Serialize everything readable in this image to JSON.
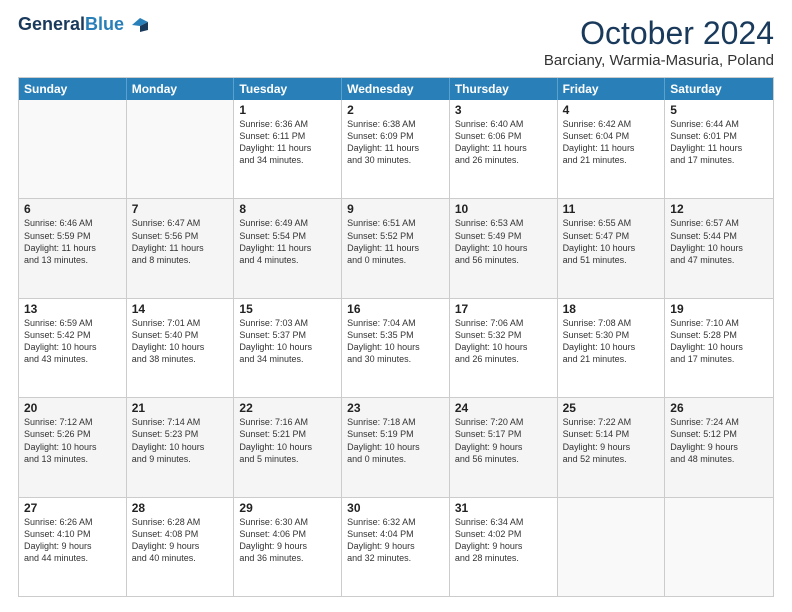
{
  "header": {
    "logo_line1": "General",
    "logo_line2": "Blue",
    "main_title": "October 2024",
    "subtitle": "Barciany, Warmia-Masuria, Poland"
  },
  "days_of_week": [
    "Sunday",
    "Monday",
    "Tuesday",
    "Wednesday",
    "Thursday",
    "Friday",
    "Saturday"
  ],
  "weeks": [
    [
      {
        "day": "",
        "text": ""
      },
      {
        "day": "",
        "text": ""
      },
      {
        "day": "1",
        "text": "Sunrise: 6:36 AM\nSunset: 6:11 PM\nDaylight: 11 hours\nand 34 minutes."
      },
      {
        "day": "2",
        "text": "Sunrise: 6:38 AM\nSunset: 6:09 PM\nDaylight: 11 hours\nand 30 minutes."
      },
      {
        "day": "3",
        "text": "Sunrise: 6:40 AM\nSunset: 6:06 PM\nDaylight: 11 hours\nand 26 minutes."
      },
      {
        "day": "4",
        "text": "Sunrise: 6:42 AM\nSunset: 6:04 PM\nDaylight: 11 hours\nand 21 minutes."
      },
      {
        "day": "5",
        "text": "Sunrise: 6:44 AM\nSunset: 6:01 PM\nDaylight: 11 hours\nand 17 minutes."
      }
    ],
    [
      {
        "day": "6",
        "text": "Sunrise: 6:46 AM\nSunset: 5:59 PM\nDaylight: 11 hours\nand 13 minutes."
      },
      {
        "day": "7",
        "text": "Sunrise: 6:47 AM\nSunset: 5:56 PM\nDaylight: 11 hours\nand 8 minutes."
      },
      {
        "day": "8",
        "text": "Sunrise: 6:49 AM\nSunset: 5:54 PM\nDaylight: 11 hours\nand 4 minutes."
      },
      {
        "day": "9",
        "text": "Sunrise: 6:51 AM\nSunset: 5:52 PM\nDaylight: 11 hours\nand 0 minutes."
      },
      {
        "day": "10",
        "text": "Sunrise: 6:53 AM\nSunset: 5:49 PM\nDaylight: 10 hours\nand 56 minutes."
      },
      {
        "day": "11",
        "text": "Sunrise: 6:55 AM\nSunset: 5:47 PM\nDaylight: 10 hours\nand 51 minutes."
      },
      {
        "day": "12",
        "text": "Sunrise: 6:57 AM\nSunset: 5:44 PM\nDaylight: 10 hours\nand 47 minutes."
      }
    ],
    [
      {
        "day": "13",
        "text": "Sunrise: 6:59 AM\nSunset: 5:42 PM\nDaylight: 10 hours\nand 43 minutes."
      },
      {
        "day": "14",
        "text": "Sunrise: 7:01 AM\nSunset: 5:40 PM\nDaylight: 10 hours\nand 38 minutes."
      },
      {
        "day": "15",
        "text": "Sunrise: 7:03 AM\nSunset: 5:37 PM\nDaylight: 10 hours\nand 34 minutes."
      },
      {
        "day": "16",
        "text": "Sunrise: 7:04 AM\nSunset: 5:35 PM\nDaylight: 10 hours\nand 30 minutes."
      },
      {
        "day": "17",
        "text": "Sunrise: 7:06 AM\nSunset: 5:32 PM\nDaylight: 10 hours\nand 26 minutes."
      },
      {
        "day": "18",
        "text": "Sunrise: 7:08 AM\nSunset: 5:30 PM\nDaylight: 10 hours\nand 21 minutes."
      },
      {
        "day": "19",
        "text": "Sunrise: 7:10 AM\nSunset: 5:28 PM\nDaylight: 10 hours\nand 17 minutes."
      }
    ],
    [
      {
        "day": "20",
        "text": "Sunrise: 7:12 AM\nSunset: 5:26 PM\nDaylight: 10 hours\nand 13 minutes."
      },
      {
        "day": "21",
        "text": "Sunrise: 7:14 AM\nSunset: 5:23 PM\nDaylight: 10 hours\nand 9 minutes."
      },
      {
        "day": "22",
        "text": "Sunrise: 7:16 AM\nSunset: 5:21 PM\nDaylight: 10 hours\nand 5 minutes."
      },
      {
        "day": "23",
        "text": "Sunrise: 7:18 AM\nSunset: 5:19 PM\nDaylight: 10 hours\nand 0 minutes."
      },
      {
        "day": "24",
        "text": "Sunrise: 7:20 AM\nSunset: 5:17 PM\nDaylight: 9 hours\nand 56 minutes."
      },
      {
        "day": "25",
        "text": "Sunrise: 7:22 AM\nSunset: 5:14 PM\nDaylight: 9 hours\nand 52 minutes."
      },
      {
        "day": "26",
        "text": "Sunrise: 7:24 AM\nSunset: 5:12 PM\nDaylight: 9 hours\nand 48 minutes."
      }
    ],
    [
      {
        "day": "27",
        "text": "Sunrise: 6:26 AM\nSunset: 4:10 PM\nDaylight: 9 hours\nand 44 minutes."
      },
      {
        "day": "28",
        "text": "Sunrise: 6:28 AM\nSunset: 4:08 PM\nDaylight: 9 hours\nand 40 minutes."
      },
      {
        "day": "29",
        "text": "Sunrise: 6:30 AM\nSunset: 4:06 PM\nDaylight: 9 hours\nand 36 minutes."
      },
      {
        "day": "30",
        "text": "Sunrise: 6:32 AM\nSunset: 4:04 PM\nDaylight: 9 hours\nand 32 minutes."
      },
      {
        "day": "31",
        "text": "Sunrise: 6:34 AM\nSunset: 4:02 PM\nDaylight: 9 hours\nand 28 minutes."
      },
      {
        "day": "",
        "text": ""
      },
      {
        "day": "",
        "text": ""
      }
    ]
  ]
}
